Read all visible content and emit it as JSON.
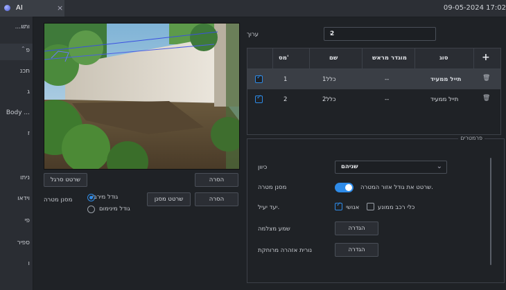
{
  "tab": {
    "title": "AI",
    "close": "×"
  },
  "datetime": "09-05-2024 17:02",
  "sidebar": {
    "items": [
      {
        "label": "...ותיו"
      },
      {
        "label": "פ"
      },
      {
        "label": "תכנ"
      },
      {
        "label": "ג"
      },
      {
        "label": "Body ..."
      },
      {
        "label": "ז"
      },
      {
        "label": "ניתו"
      },
      {
        "label": "וידאו"
      },
      {
        "label": "פי"
      },
      {
        "label": "ספיר"
      },
      {
        "label": "ו"
      }
    ]
  },
  "edit": {
    "label": "ערוך",
    "value": "2"
  },
  "table": {
    "headers": {
      "num": "מס'",
      "name": "שם",
      "preset": "מוגדר מראש",
      "type": "סוג",
      "add": "+"
    },
    "rows": [
      {
        "num": "1",
        "name": "כלל1",
        "preset": "--",
        "type": "תייל ממעיד",
        "checked": true
      },
      {
        "num": "2",
        "name": "כלל2",
        "preset": "--",
        "type": "תייל ממעיד",
        "checked": true
      }
    ]
  },
  "video_controls": {
    "remove1": "הסרה",
    "draw_ruler": "שרטט סרגל",
    "remove2": "הסרה",
    "draw_filter": "שרטט מסנן",
    "filter_label": "מסנן מטרה",
    "max_size": "גודל מירבי",
    "min_size": "גודל מינימום"
  },
  "params": {
    "title": "פרמטרים",
    "direction_label": "כיוון",
    "direction_value": "שניהם",
    "filter_label": "מסנן מטרה",
    "filter_desc": "שרטט את גודל אזור המטרה.",
    "target_label": "יעד יעיל.",
    "human": "אנושי",
    "vehicle": "כלי רכב ממונע",
    "camera_label": "שמע מצלמה",
    "camera_btn": "הגדרה",
    "light_label": "נורית אזהרה מרוחקת",
    "light_btn": "הגדרה"
  },
  "colors": {
    "accent": "#2e8be8",
    "bg": "#1f2226"
  }
}
